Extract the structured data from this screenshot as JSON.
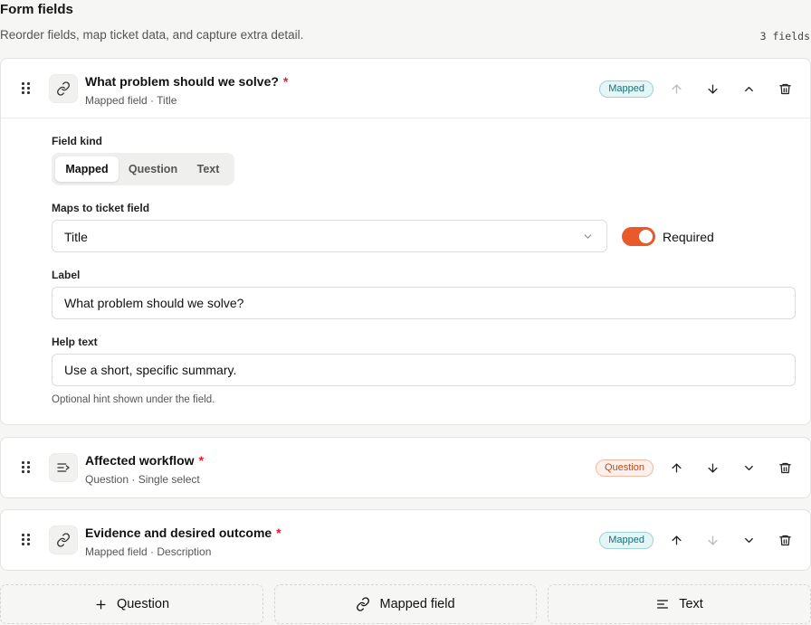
{
  "header": {
    "title": "Form fields",
    "subtitle": "Reorder fields, map ticket data, and capture extra detail.",
    "count": "3 fields"
  },
  "fields": [
    {
      "name": "What problem should we solve?",
      "required_mark": "*",
      "meta": "Mapped field · Title",
      "badge": "Mapped",
      "kind_icon": "link-icon",
      "expanded": true
    },
    {
      "name": "Affected workflow",
      "required_mark": "*",
      "meta": "Question · Single select",
      "badge": "Question",
      "kind_icon": "list-icon",
      "expanded": false
    },
    {
      "name": "Evidence and desired outcome",
      "required_mark": "*",
      "meta": "Mapped field · Description",
      "badge": "Mapped",
      "kind_icon": "link-icon",
      "expanded": false
    }
  ],
  "editor": {
    "kind_label": "Field kind",
    "kind_options": [
      "Mapped",
      "Question",
      "Text"
    ],
    "kind_selected": "Mapped",
    "maps_label": "Maps to ticket field",
    "maps_value": "Title",
    "required_label": "Required",
    "required_on": true,
    "label_label": "Label",
    "label_value": "What problem should we solve?",
    "help_label": "Help text",
    "help_value": "Use a short, specific summary.",
    "help_hint": "Optional hint shown under the field."
  },
  "add_buttons": {
    "question": "Question",
    "mapped": "Mapped field",
    "text": "Text"
  },
  "colors": {
    "accent": "#e85a2a",
    "mapped_badge": "#1a6f78",
    "question_badge": "#c2461c",
    "required_star": "#e11d2e"
  }
}
